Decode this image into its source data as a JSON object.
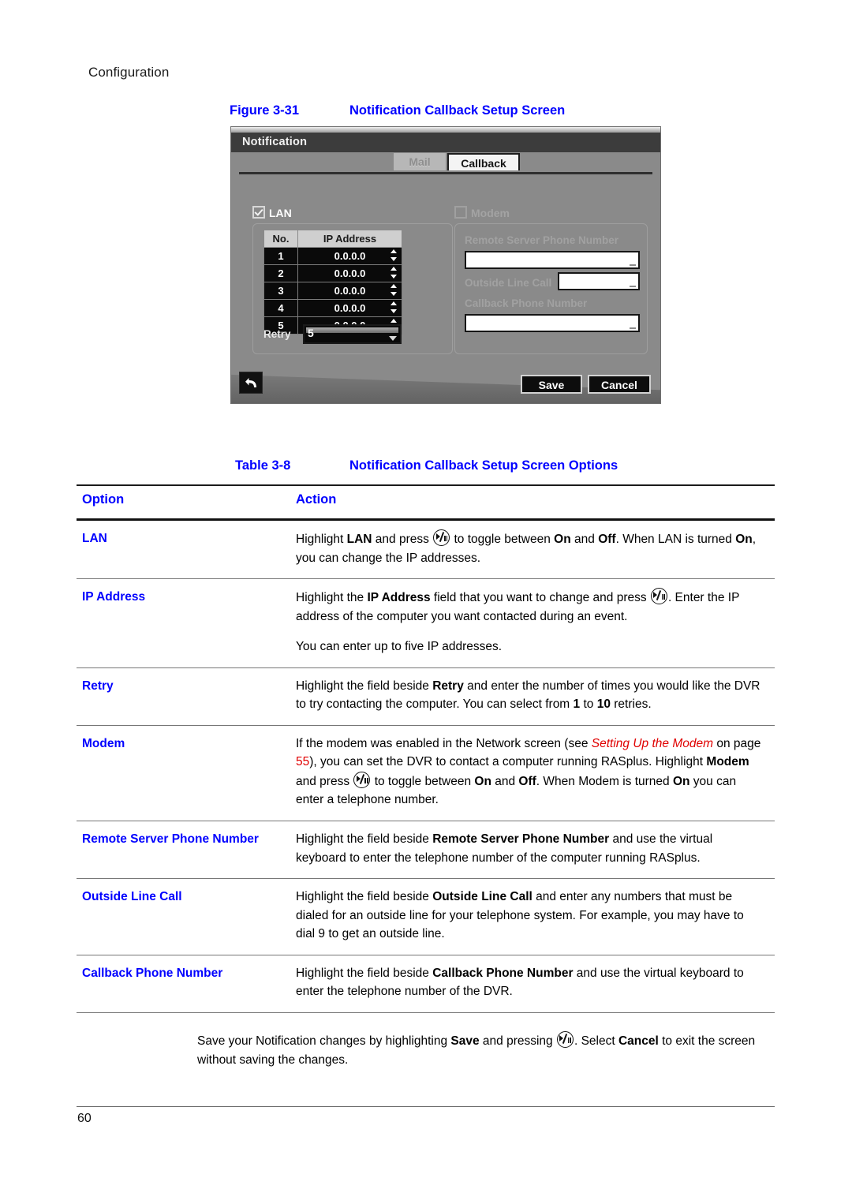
{
  "page": {
    "running_head": "Configuration",
    "folio": "60"
  },
  "figure": {
    "number": "Figure 3-31",
    "title": "Notification Callback Setup Screen"
  },
  "dvr_screen": {
    "window_title": "Notification",
    "tabs": [
      {
        "label": "Mail",
        "active": false
      },
      {
        "label": "Callback",
        "active": true
      }
    ],
    "lan": {
      "checkbox_label": "LAN",
      "checked": true,
      "table": {
        "headers": [
          "No.",
          "IP Address"
        ],
        "rows": [
          {
            "no": "1",
            "ip": "0.0.0.0"
          },
          {
            "no": "2",
            "ip": "0.0.0.0"
          },
          {
            "no": "3",
            "ip": "0.0.0.0"
          },
          {
            "no": "4",
            "ip": "0.0.0.0"
          },
          {
            "no": "5",
            "ip": "0.0.0.0"
          }
        ]
      },
      "retry_label": "Retry",
      "retry_value": "5"
    },
    "modem": {
      "checkbox_label": "Modem",
      "checked": false,
      "remote_server_phone_label": "Remote Server Phone Number",
      "remote_server_phone_value": "",
      "outside_line_call_label": "Outside Line Call",
      "outside_line_call_value": "",
      "callback_phone_label": "Callback Phone Number",
      "callback_phone_value": ""
    },
    "buttons": {
      "save": "Save",
      "cancel": "Cancel",
      "back": "back-arrow"
    }
  },
  "table_3_8": {
    "caption_number": "Table 3-8",
    "caption_title": "Notification Callback Setup Screen Options",
    "headers": [
      "Option",
      "Action"
    ],
    "rows": [
      {
        "option": "LAN",
        "action_text": "Highlight LAN and press (toggle key) to toggle between On and Off. When LAN is turned On, you can change the IP addresses."
      },
      {
        "option": "IP Address",
        "action_text": "Highlight the IP Address field that you want to change and press (toggle key). Enter the IP address of the computer you want contacted during an event.",
        "action_text_2": "You can enter up to five IP addresses."
      },
      {
        "option": "Retry",
        "action_text": "Highlight the field beside Retry and enter the number of times you would like the DVR to try contacting the computer. You can select from 1 to 10 retries."
      },
      {
        "option": "Modem",
        "action_text": "If the modem was enabled in the Network screen (see Setting Up the Modem on page 55), you can set the DVR to contact a computer running RASplus. Highlight Modem and press (toggle key) to toggle between On and Off. When Modem is turned On you can enter a telephone number.",
        "xref": "Setting Up the Modem",
        "xref_page": "55"
      },
      {
        "option": "Remote Server Phone Number",
        "action_text": "Highlight the field beside Remote Server Phone Number and use the virtual keyboard to enter the telephone number of the computer running RASplus."
      },
      {
        "option": "Outside Line Call",
        "action_text": "Highlight the field beside Outside Line Call and enter any numbers that must be dialed for an outside line for your telephone system. For example, you may have to dial 9 to get an outside line."
      },
      {
        "option": "Callback Phone Number",
        "action_text": "Highlight the field beside Callback Phone Number and use the virtual keyboard to enter the telephone number of the DVR."
      }
    ]
  },
  "closing_paragraph": {
    "text": "Save your Notification changes by highlighting Save and pressing (toggle key). Select Cancel to exit the screen without saving the changes."
  },
  "colors": {
    "heading_blue": "#0000ff",
    "xref_red": "#e00000",
    "dvr_background": "#8a8a8a"
  }
}
